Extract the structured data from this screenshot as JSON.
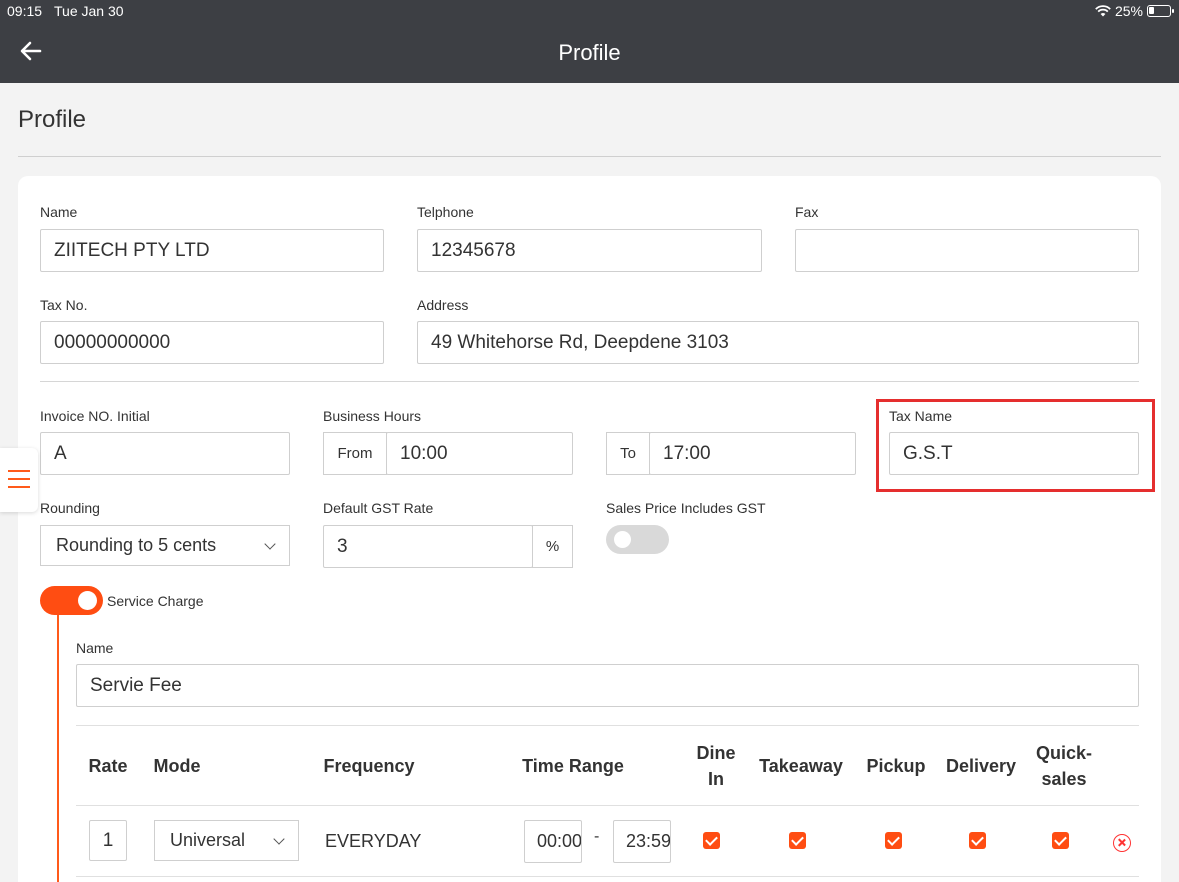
{
  "status_bar": {
    "time": "09:15",
    "date": "Tue Jan 30",
    "battery": "25%"
  },
  "app_bar": {
    "title": "Profile"
  },
  "page": {
    "title": "Profile"
  },
  "form": {
    "name": {
      "label": "Name",
      "value": "ZIITECH PTY LTD"
    },
    "telephone": {
      "label": "Telphone",
      "value": "12345678"
    },
    "fax": {
      "label": "Fax",
      "value": ""
    },
    "tax_no": {
      "label": "Tax No.",
      "value": "00000000000"
    },
    "address": {
      "label": "Address",
      "value": "49 Whitehorse Rd, Deepdene 3103"
    },
    "invoice_initial": {
      "label": "Invoice NO. Initial",
      "value": "A"
    },
    "business_hours": {
      "label": "Business Hours",
      "from_label": "From",
      "from": "10:00",
      "to_label": "To",
      "to": "17:00"
    },
    "tax_name": {
      "label": "Tax Name",
      "value": "G.S.T"
    },
    "rounding": {
      "label": "Rounding",
      "value": "Rounding to 5 cents"
    },
    "gst_rate": {
      "label": "Default GST Rate",
      "value": "3",
      "unit": "%"
    },
    "sales_price_includes_gst": {
      "label": "Sales Price Includes GST",
      "enabled": false
    },
    "service_charge": {
      "label": "Service Charge",
      "enabled": true,
      "name_label": "Name",
      "name_value": "Servie Fee",
      "columns": [
        "Rate",
        "Mode",
        "Frequency",
        "Time Range",
        "Dine In",
        "Takeaway",
        "Pickup",
        "Delivery",
        "Quick-sales"
      ],
      "rows": [
        {
          "rate": "1",
          "mode": "Universal",
          "frequency": "EVERYDAY",
          "time_start": "00:00",
          "time_sep": "-",
          "time_end": "23:59",
          "dine_in": true,
          "takeaway": true,
          "pickup": true,
          "delivery": true,
          "quick_sales": true
        }
      ]
    }
  },
  "colors": {
    "accent": "#ff4d12",
    "header": "#3d3f44",
    "highlight": "#e52e2e"
  }
}
